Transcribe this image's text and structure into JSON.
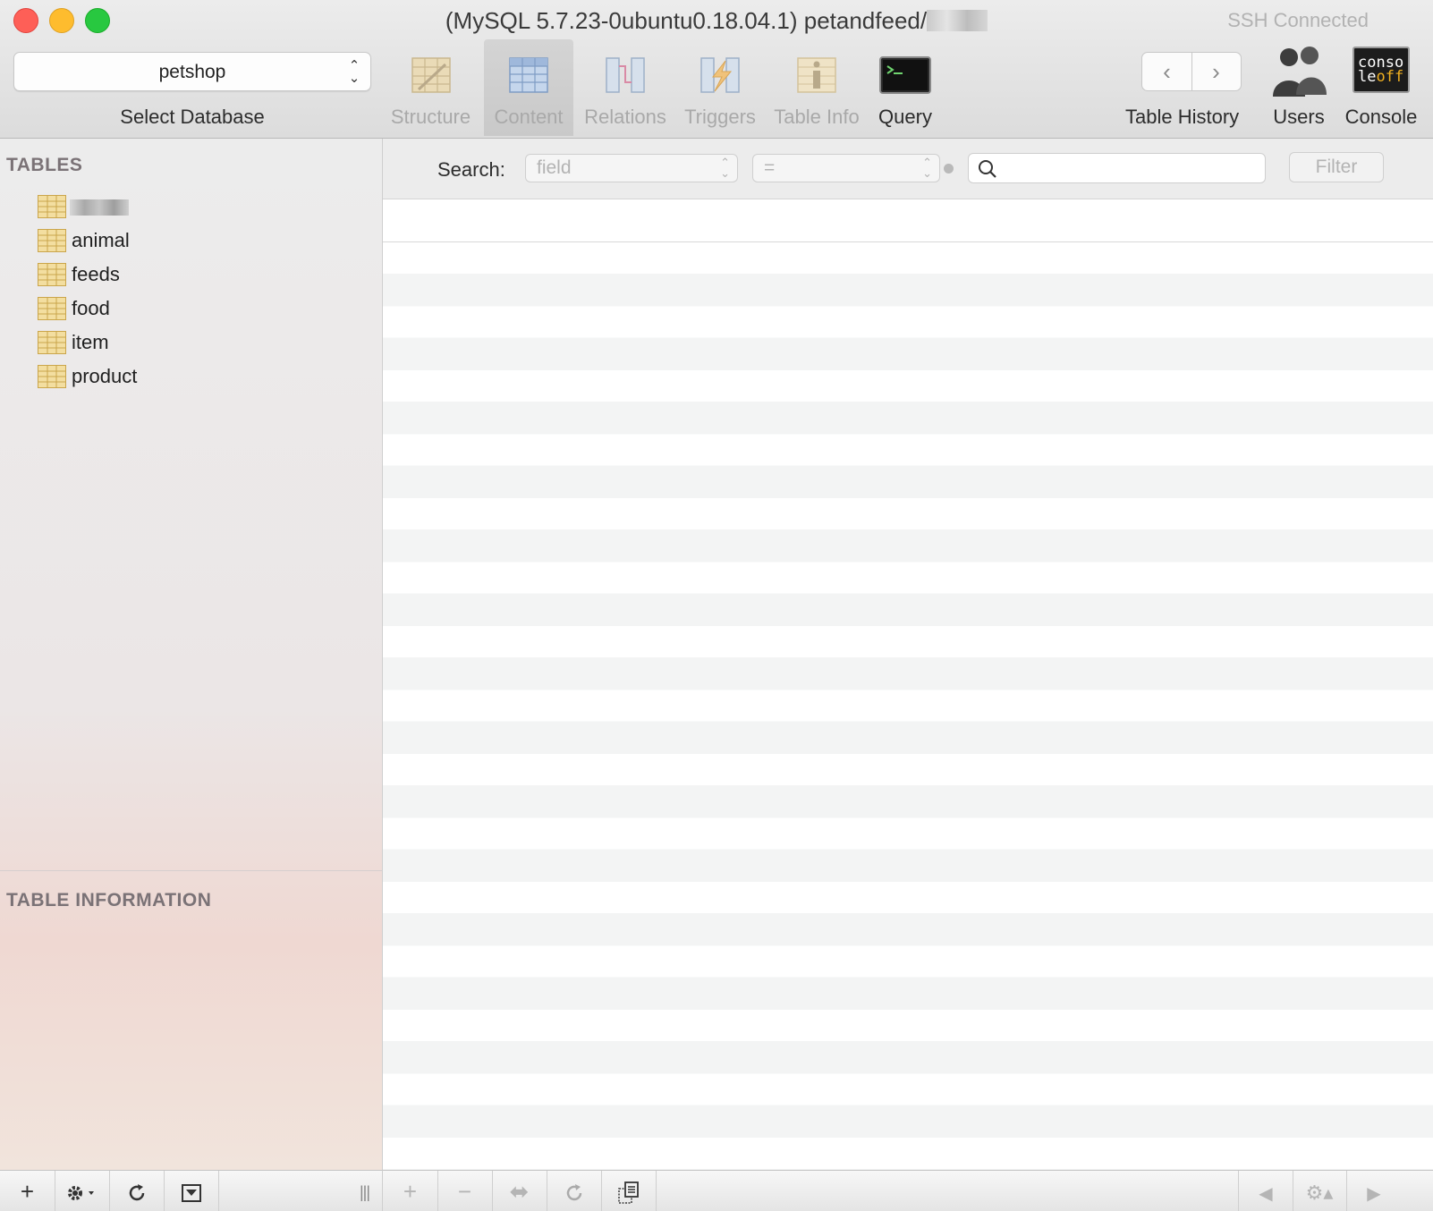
{
  "window": {
    "title": "(MySQL 5.7.23-0ubuntu0.18.04.1) petandfeed/",
    "status": "SSH Connected"
  },
  "toolbar": {
    "database_selected": "petshop",
    "database_label": "Select Database",
    "buttons": [
      {
        "label": "Structure",
        "icon": "structure-icon",
        "enabled": false
      },
      {
        "label": "Content",
        "icon": "content-icon",
        "active": true
      },
      {
        "label": "Relations",
        "icon": "relations-icon",
        "enabled": false
      },
      {
        "label": "Triggers",
        "icon": "triggers-icon",
        "enabled": false
      },
      {
        "label": "Table Info",
        "icon": "table-info-icon",
        "enabled": false
      },
      {
        "label": "Query",
        "icon": "query-icon",
        "enabled": true
      }
    ],
    "history_label": "Table History",
    "users_label": "Users",
    "console_label": "Console",
    "console_icon_text_1": "conso",
    "console_icon_text_2a": "le",
    "console_icon_text_2b": "off"
  },
  "sidebar": {
    "tables_header": "TABLES",
    "tables": [
      "",
      "animal",
      "feeds",
      "food",
      "item",
      "product"
    ],
    "info_header": "TABLE INFORMATION"
  },
  "search": {
    "label": "Search:",
    "field_placeholder": "field",
    "operator": "=",
    "value": "",
    "filter_label": "Filter"
  },
  "colors": {
    "close": "#fe5f57",
    "minimize": "#febc2e",
    "maximize": "#28c840",
    "table_icon": "#e9cf7a",
    "row_stripe": "#f3f4f4"
  }
}
